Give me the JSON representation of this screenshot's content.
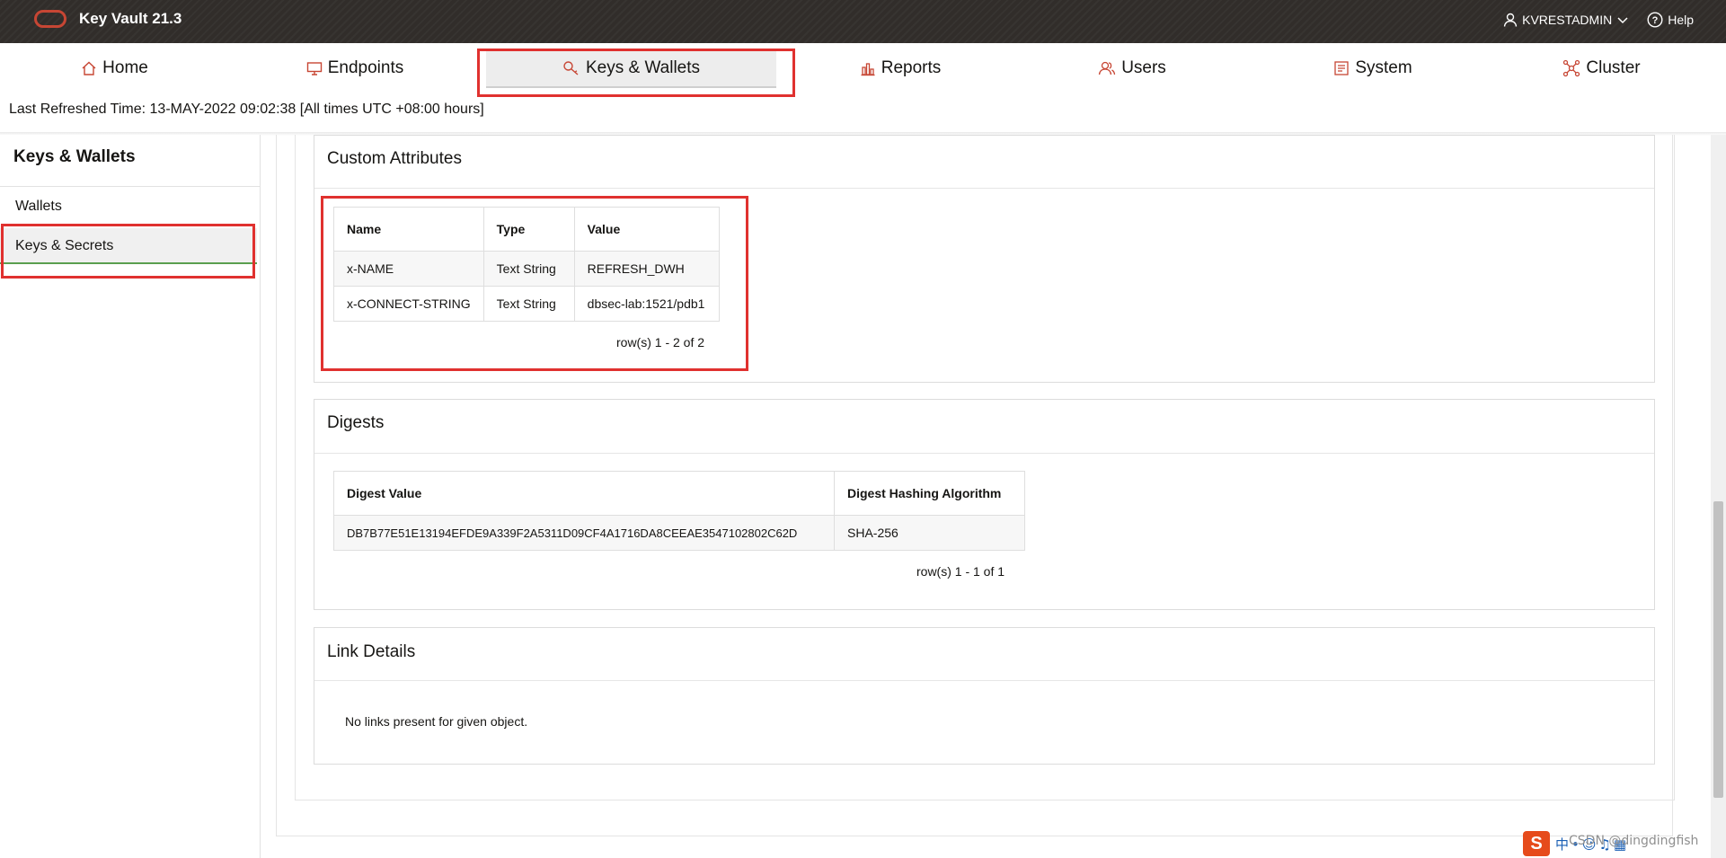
{
  "header": {
    "app_title": "Key Vault 21.3",
    "user_name": "KVRESTADMIN",
    "help_label": "Help"
  },
  "nav": {
    "tabs": [
      {
        "label": "Home",
        "icon": "home-icon"
      },
      {
        "label": "Endpoints",
        "icon": "monitor-icon"
      },
      {
        "label": "Keys & Wallets",
        "icon": "key-icon",
        "active": true
      },
      {
        "label": "Reports",
        "icon": "bar-chart-icon"
      },
      {
        "label": "Users",
        "icon": "users-icon"
      },
      {
        "label": "System",
        "icon": "system-icon"
      },
      {
        "label": "Cluster",
        "icon": "cluster-icon"
      }
    ]
  },
  "refresh_text": "Last Refreshed Time: 13-MAY-2022 09:02:38 [All times UTC +08:00 hours]",
  "sidebar": {
    "title": "Keys & Wallets",
    "items": [
      {
        "label": "Wallets"
      },
      {
        "label": "Keys & Secrets",
        "active": true
      }
    ]
  },
  "custom_attributes": {
    "title": "Custom Attributes",
    "columns": [
      "Name",
      "Type",
      "Value"
    ],
    "rows": [
      [
        "x-NAME",
        "Text String",
        "REFRESH_DWH"
      ],
      [
        "x-CONNECT-STRING",
        "Text String",
        "dbsec-lab:1521/pdb1"
      ]
    ],
    "pagination": "row(s) 1 - 2 of 2"
  },
  "digests": {
    "title": "Digests",
    "columns": [
      "Digest Value",
      "Digest Hashing Algorithm"
    ],
    "rows": [
      [
        "DB7B77E51E13194EFDE9A339F2A5311D09CF4A1716DA8CEEAE3547102802C62D",
        "SHA-256"
      ]
    ],
    "pagination": "row(s) 1 - 1 of 1"
  },
  "link_details": {
    "title": "Link Details",
    "message": "No links present for given object."
  },
  "watermark": "CSDN @dingdingfish",
  "colors": {
    "header_bg": "#312d2a",
    "brand_red": "#c74634",
    "highlight_red": "#e0312f",
    "active_green": "#5a9f4f"
  }
}
